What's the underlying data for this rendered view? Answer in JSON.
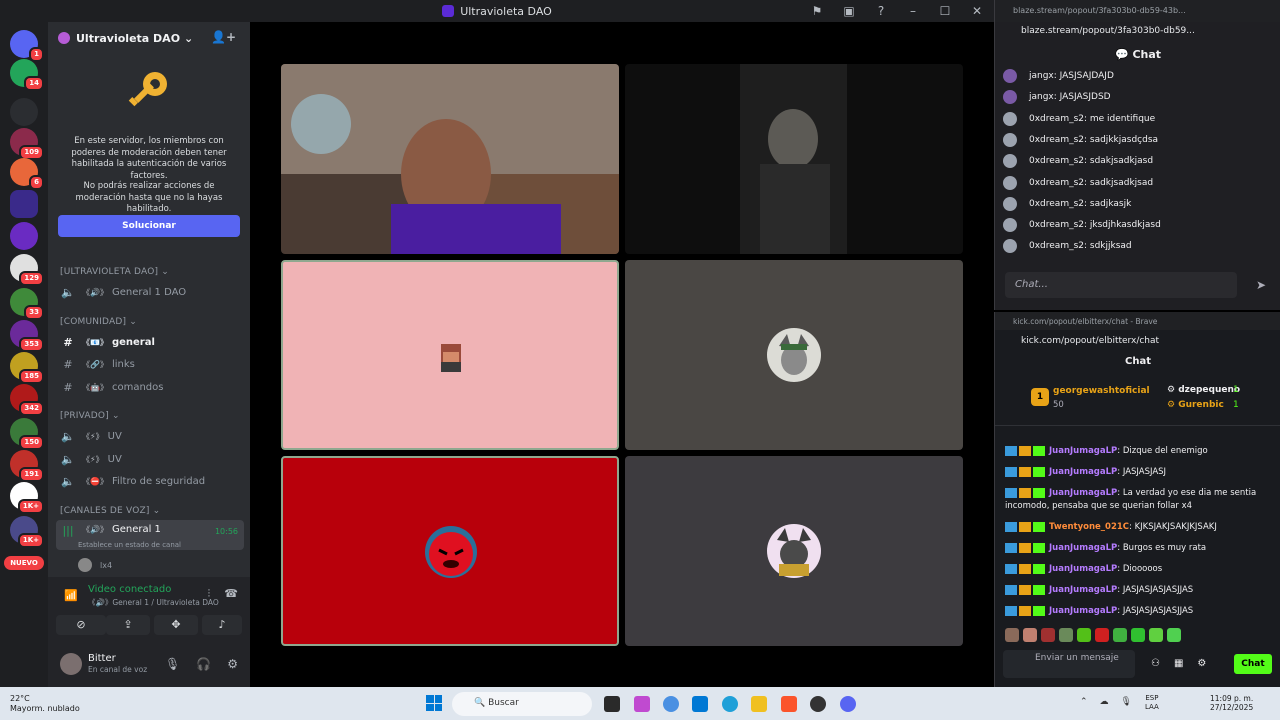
{
  "titlebar": {
    "title": "Ultravioleta DAO"
  },
  "rail": {
    "servers": [
      {
        "name": "discord-home",
        "badge": "1",
        "color": "#5865f2"
      },
      {
        "name": "server-a",
        "badge": "14",
        "color": "#23a55a"
      },
      {
        "name": "server-vs",
        "badge": "",
        "color": "#2b2d31"
      },
      {
        "name": "server-b",
        "badge": "109",
        "color": "#8b2a4b"
      },
      {
        "name": "server-c",
        "badge": "6",
        "color": "#e8673a"
      },
      {
        "name": "server-ultravioleta",
        "badge": "",
        "color": "#3a2a8a"
      },
      {
        "name": "server-d",
        "badge": "",
        "color": "#6a2bc2"
      },
      {
        "name": "server-e",
        "badge": "129",
        "color": "#e0e0e0"
      },
      {
        "name": "server-f",
        "badge": "33",
        "color": "#3f8a3a"
      },
      {
        "name": "server-g",
        "badge": "353",
        "color": "#6b2a9a"
      },
      {
        "name": "server-h",
        "badge": "185",
        "color": "#c0a020"
      },
      {
        "name": "server-i",
        "badge": "342",
        "color": "#b01a1a"
      },
      {
        "name": "server-j",
        "badge": "150",
        "color": "#3a7a3a"
      },
      {
        "name": "server-k",
        "badge": "191",
        "color": "#c0302a"
      },
      {
        "name": "server-l",
        "badge": "1K+",
        "color": "#ffffff"
      },
      {
        "name": "server-m",
        "badge": "1K+",
        "color": "#4a4a8a"
      }
    ],
    "nuevo": "NUEVO"
  },
  "sidebar": {
    "server_name": "Ultravioleta DAO",
    "mfa": {
      "text1": "En este servidor, los miembros con poderes de moderación deben tener habilitada la autenticación de varios factores.",
      "text2": "No podrás realizar acciones de moderación hasta que no la hayas habilitado.",
      "button": "Solucionar"
    },
    "categories": [
      {
        "label": "[ULTRAVIOLETA DAO]"
      },
      {
        "label": "[COMUNIDAD]"
      },
      {
        "label": "[PRIVADO]"
      },
      {
        "label": "[CANALES DE VOZ]"
      }
    ],
    "channels": [
      {
        "icon": "🔊",
        "label": "General 1 DAO",
        "prefix": "《🔊》"
      },
      {
        "icon": "#",
        "label": "general",
        "prefix": "《📧》"
      },
      {
        "icon": "#",
        "label": "links",
        "prefix": "《🔗》"
      },
      {
        "icon": "#",
        "label": "comandos",
        "prefix": "《🤖》"
      },
      {
        "icon": "🔊",
        "label": "UV",
        "prefix": "《⚡》"
      },
      {
        "icon": "🔊",
        "label": "UV",
        "prefix": "《⚡》"
      },
      {
        "icon": "🔊",
        "label": "Filtro de seguridad",
        "prefix": "《⛔》"
      },
      {
        "icon": "🔊",
        "label": "General 1",
        "prefix": "《🔊》"
      }
    ],
    "voice_channel_status": "Establece un estado de canal",
    "voice_time": "10:56",
    "voice_member": "lx4",
    "voice_panel": {
      "title": "Video conectado",
      "subtitle": "《🔊》General 1 / Ultravioleta DAO"
    },
    "user": {
      "name": "Bitter",
      "status": "En canal de voz"
    }
  },
  "chat1": {
    "tab_title": "blaze.stream/popout/3fa303b0-db59-43b...",
    "url": "blaze.stream/popout/3fa303b0-db59...",
    "header": "Chat",
    "messages": [
      {
        "user": "jangx",
        "text": "JASJSAJDAJD"
      },
      {
        "user": "jangx",
        "text": "JASJASJDSD"
      },
      {
        "user": "0xdream_s2",
        "text": "me identifique"
      },
      {
        "user": "0xdream_s2",
        "text": "sadjkkjasdçdsa"
      },
      {
        "user": "0xdream_s2",
        "text": "sdakjsadkjasd"
      },
      {
        "user": "0xdream_s2",
        "text": "sadkjsadkjsad"
      },
      {
        "user": "0xdream_s2",
        "text": "sadjkasjk"
      },
      {
        "user": "0xdream_s2",
        "text": "jksdjhkasdkjasd"
      },
      {
        "user": "0xdream_s2",
        "text": "sdkjjksad"
      }
    ],
    "input_placeholder": "Chat..."
  },
  "chat2": {
    "tab_title": "kick.com/popout/elbitterx/chat - Brave",
    "url": "kick.com/popout/elbitterx/chat",
    "header": "Chat",
    "leader": {
      "rank": "1",
      "top_user": "georgewashtoficial",
      "top_amount": "50",
      "u2": "dzepequeno",
      "u2_amount": "1",
      "u3": "Gurenbic",
      "u3_amount": "1"
    },
    "messages": [
      {
        "user": "JuanJumagaLP",
        "text": "Dizque del enemigo",
        "color": "#b57cff"
      },
      {
        "user": "JuanJumagaLP",
        "text": "JASJASJASJ",
        "color": "#b57cff"
      },
      {
        "user": "JuanJumagaLP",
        "text": "La verdad yo ese dia me sentia incomodo, pensaba que se querian follar x4",
        "color": "#b57cff"
      },
      {
        "user": "Twentyone_021C",
        "text": "KJKSJAKJSAKJKJSAKJ",
        "color": "#ff8c3a"
      },
      {
        "user": "JuanJumagaLP",
        "text": "Burgos es muy rata",
        "color": "#b57cff"
      },
      {
        "user": "JuanJumagaLP",
        "text": "Diooooos",
        "color": "#b57cff"
      },
      {
        "user": "JuanJumagaLP",
        "text": "JASJASJASJASJJAS",
        "color": "#b57cff"
      },
      {
        "user": "JuanJumagaLP",
        "text": "JASJASJASJASJJAS",
        "color": "#b57cff"
      }
    ],
    "input_placeholder": "Enviar un mensaje",
    "send_button": "Chat"
  },
  "video_tiles": [
    {
      "name": "webcam-participant",
      "bg": "#3b2f2a"
    },
    {
      "name": "dark-webcam-participant",
      "bg": "#111111"
    },
    {
      "name": "pixel-avatar-participant",
      "bg": "#f0b3b5"
    },
    {
      "name": "wolf-avatar-participant",
      "bg": "#4a4744"
    },
    {
      "name": "red-avatar-participant",
      "bg": "#b8000b"
    },
    {
      "name": "cat-avatar-participant",
      "bg": "#3d3b3f"
    }
  ],
  "taskbar": {
    "weather_temp": "22°C",
    "weather_desc": "Mayorm. nublado",
    "search": "Buscar",
    "lang1": "ESP",
    "lang2": "LAA",
    "time": "11:09 p. m.",
    "date": "27/12/2025"
  }
}
